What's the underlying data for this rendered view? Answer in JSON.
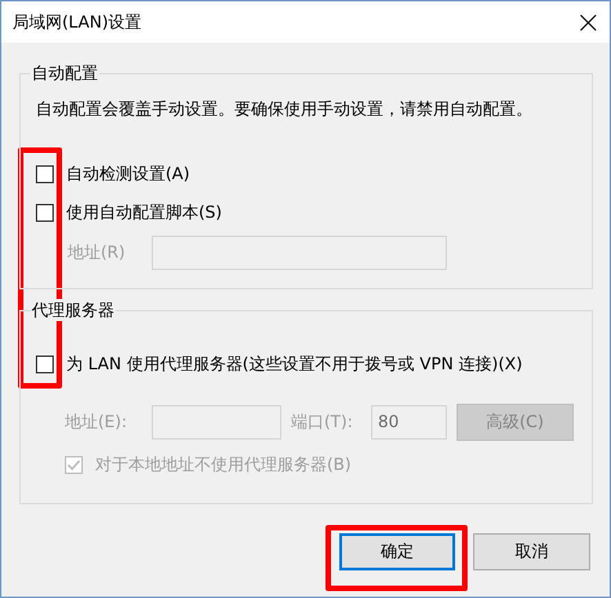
{
  "window": {
    "title": "局域网(LAN)设置"
  },
  "auto_config": {
    "legend": "自动配置",
    "description": "自动配置会覆盖手动设置。要确保使用手动设置，请禁用自动配置。",
    "options": [
      {
        "label": "自动检测设置(A)",
        "checked": false,
        "disabled": false
      },
      {
        "label": "使用自动配置脚本(S)",
        "checked": false,
        "disabled": false
      }
    ],
    "address": {
      "label": "地址(R)",
      "disabled": true
    }
  },
  "proxy": {
    "legend": "代理服务器",
    "use_proxy": {
      "label": "为 LAN 使用代理服务器(这些设置不用于拨号或 VPN 连接)(X)",
      "checked": false,
      "disabled": false
    },
    "address": {
      "label": "地址(E):",
      "disabled": true
    },
    "port": {
      "label": "端口(T):",
      "value": "80",
      "disabled": true
    },
    "advanced": {
      "label": "高级(C)",
      "disabled": true
    },
    "bypass_local": {
      "label": "对于本地地址不使用代理服务器(B)",
      "checked": true,
      "disabled": true
    }
  },
  "buttons": [
    {
      "label": "确定",
      "default": true
    },
    {
      "label": "取消",
      "default": false
    }
  ]
}
